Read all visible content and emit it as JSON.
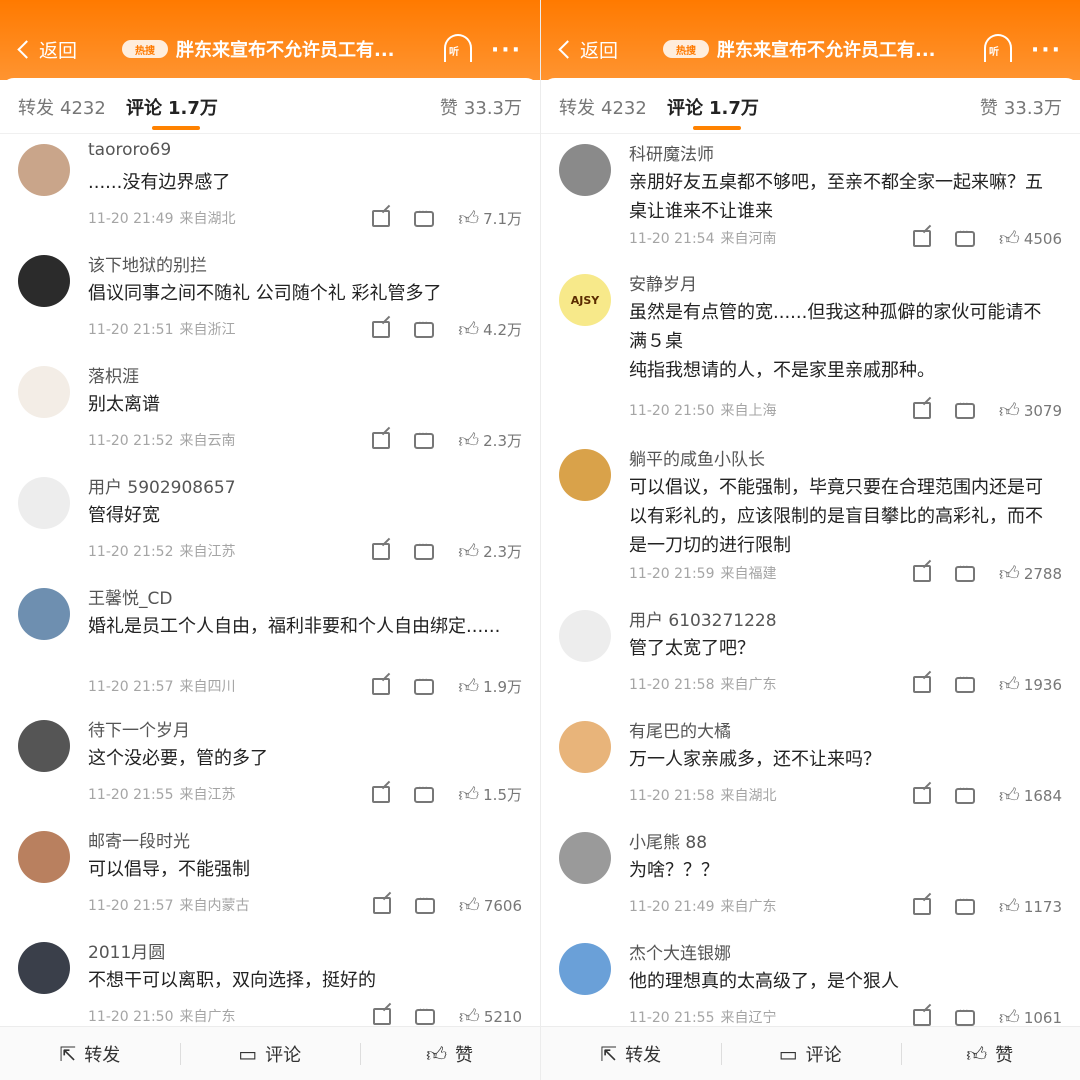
{
  "header": {
    "back_label": "返回",
    "hot_badge": "热搜",
    "title": "胖东来宣布不允许员工有...",
    "listen_label": "听",
    "more_label": "···"
  },
  "tabs": {
    "repost_label": "转发",
    "repost_count": "4232",
    "comment_label": "评论",
    "comment_count": "1.7万",
    "like_label": "赞",
    "like_count": "33.3万"
  },
  "bottom": {
    "repost": "转发",
    "comment": "评论",
    "like": "赞"
  },
  "left_comments": [
    {
      "user": "taororo69",
      "text": "......没有边界感了",
      "time": "11-20 21:49",
      "src": "来自湖北",
      "likes": "7.1万",
      "avatar_color": "#c9a58a"
    },
    {
      "user": "该下地狱的别拦",
      "text": "倡议同事之间不随礼 公司随个礼 彩礼管多了",
      "time": "11-20 21:51",
      "src": "来自浙江",
      "likes": "4.2万",
      "avatar_color": "#2b2b2b"
    },
    {
      "user": "落枳涯",
      "text": "别太离谱",
      "time": "11-20 21:52",
      "src": "来自云南",
      "likes": "2.3万",
      "avatar_color": "#f3ede6"
    },
    {
      "user": "用户 5902908657",
      "text": "管得好宽",
      "time": "11-20 21:52",
      "src": "来自江苏",
      "likes": "2.3万",
      "avatar_color": "#ededed"
    },
    {
      "user": "王馨悦_CD",
      "text": "婚礼是员工个人自由，福利非要和个人自由绑定......",
      "time": "11-20 21:57",
      "src": "来自四川",
      "likes": "1.9万",
      "avatar_color": "#6e8fb0"
    },
    {
      "user": "待下一个岁月",
      "text": "这个没必要，管的多了",
      "time": "11-20 21:55",
      "src": "来自江苏",
      "likes": "1.5万",
      "avatar_color": "#555555"
    },
    {
      "user": "邮寄一段时光",
      "text": "可以倡导，不能强制",
      "time": "11-20 21:57",
      "src": "来自内蒙古",
      "likes": "7606",
      "avatar_color": "#b9805f"
    },
    {
      "user": "2011月圆",
      "text": "不想干可以离职，双向选择，挺好的",
      "time": "11-20 21:50",
      "src": "来自广东",
      "likes": "5210",
      "avatar_color": "#3a3f4a"
    }
  ],
  "right_comments": [
    {
      "user": "科研魔法师",
      "text": "亲朋好友五桌都不够吧，至亲不都全家一起来嘛？五桌让谁来不让谁来",
      "time": "11-20 21:54",
      "src": "来自河南",
      "likes": "4506",
      "avatar_color": "#8a8a8a"
    },
    {
      "user": "安静岁月",
      "text": "虽然是有点管的宽......但我这种孤僻的家伙可能请不满５桌",
      "text2": "纯指我想请的人，不是家里亲戚那种。",
      "time": "11-20 21:50",
      "src": "来自上海",
      "likes": "3079",
      "avatar_color": "#f7e98a",
      "avatar_text": "AJSY"
    },
    {
      "user": "躺平的咸鱼小队长",
      "text": "可以倡议，不能强制，毕竟只要在合理范围内还是可以有彩礼的，应该限制的是盲目攀比的高彩礼，而不是一刀切的进行限制",
      "time": "11-20 21:59",
      "src": "来自福建",
      "likes": "2788",
      "avatar_color": "#d9a24a"
    },
    {
      "user": "用户 6103271228",
      "text": "管了太宽了吧？",
      "time": "11-20 21:58",
      "src": "来自广东",
      "likes": "1936",
      "avatar_color": "#ededed"
    },
    {
      "user": "有尾巴的大橘",
      "text": "万一人家亲戚多，还不让来吗？",
      "time": "11-20 21:58",
      "src": "来自湖北",
      "likes": "1684",
      "avatar_color": "#e8b47a"
    },
    {
      "user": "小尾熊 88",
      "text": "为啥？？？",
      "time": "11-20 21:49",
      "src": "来自广东",
      "likes": "1173",
      "avatar_color": "#9a9a9a"
    },
    {
      "user": "杰个大连银娜",
      "text": "他的理想真的太高级了，是个狠人",
      "time": "11-20 21:55",
      "src": "来自辽宁",
      "likes": "1061",
      "avatar_color": "#6aa0d8"
    }
  ]
}
